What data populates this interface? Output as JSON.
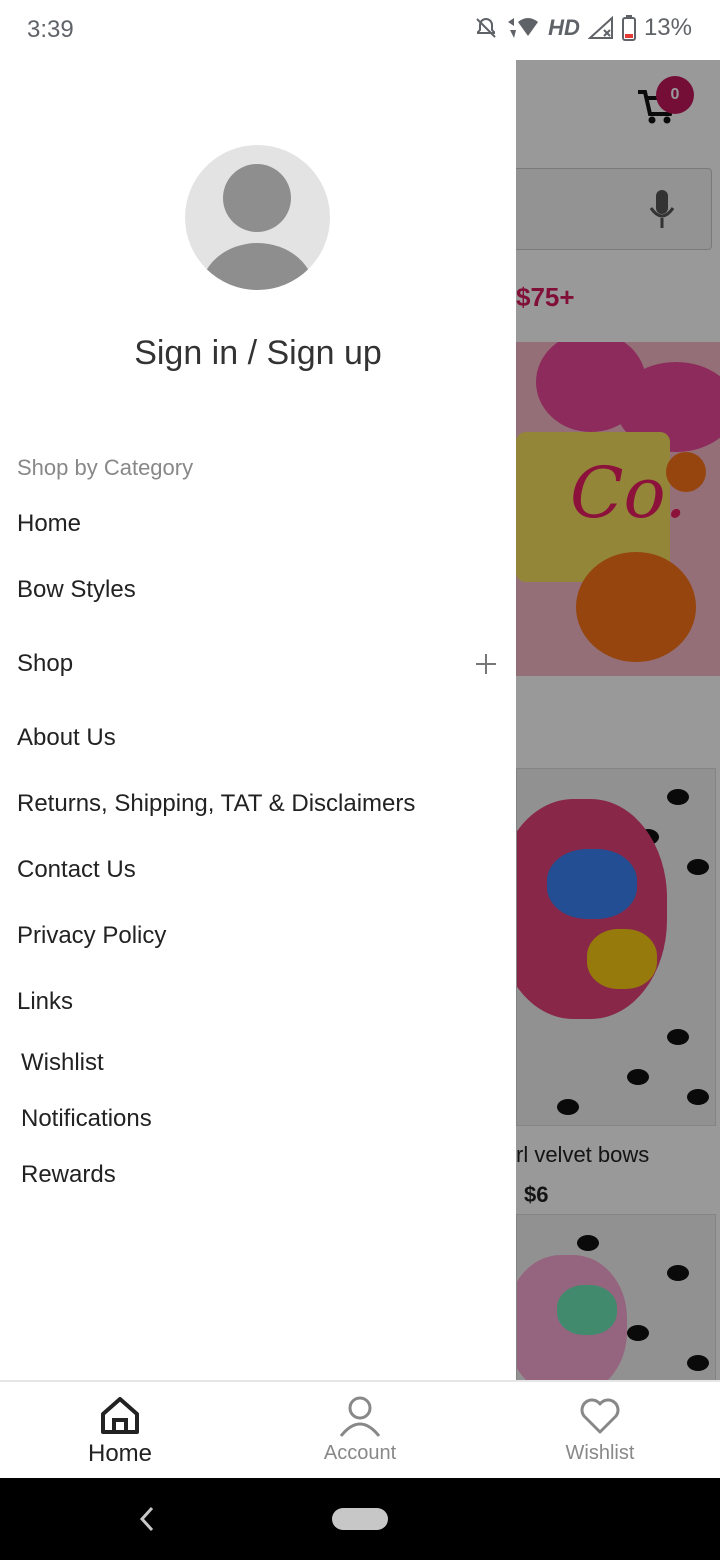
{
  "status_bar": {
    "time": "3:39",
    "network_label": "HD",
    "battery": "13%",
    "icons": [
      "bell-off-icon",
      "wifi-icon",
      "signal-icon",
      "battery-icon"
    ]
  },
  "background": {
    "cart_count": "0",
    "promo_text": "$75+",
    "banner_script": "Co.",
    "product_title": "rl velvet bows",
    "product_price": "$6",
    "accent_color": "#c2185b"
  },
  "drawer": {
    "signin_label": "Sign in / Sign up",
    "section_label": "Shop by Category",
    "items": [
      {
        "label": "Home"
      },
      {
        "label": "Bow Styles"
      },
      {
        "label": "Shop",
        "expandable": true
      },
      {
        "label": "About Us"
      },
      {
        "label": "Returns, Shipping, TAT & Disclaimers"
      },
      {
        "label": "Contact Us"
      },
      {
        "label": "Privacy Policy"
      },
      {
        "label": "Links"
      }
    ],
    "extras": [
      {
        "label": "Wishlist"
      },
      {
        "label": "Notifications"
      },
      {
        "label": "Rewards"
      }
    ]
  },
  "bottom_nav": {
    "items": [
      {
        "label": "Home",
        "icon": "home-icon",
        "active": true
      },
      {
        "label": "Account",
        "icon": "person-icon",
        "active": false
      },
      {
        "label": "Wishlist",
        "icon": "heart-icon",
        "active": false
      }
    ]
  }
}
